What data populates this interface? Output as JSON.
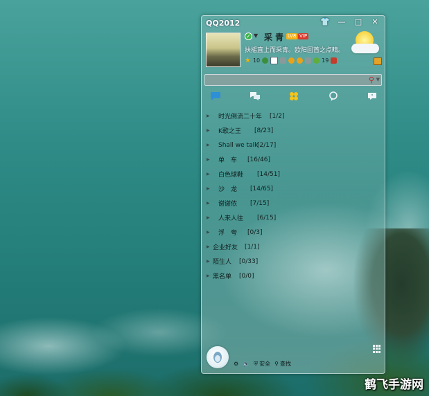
{
  "window": {
    "title": "QQ2012",
    "buttons": [
      "skin",
      "minimize",
      "maximize",
      "close"
    ]
  },
  "profile": {
    "nickname": "采 青",
    "badge_level": "LV8",
    "badge_vip": "VIP",
    "signature": "扶摇直上而采青。欧阳回首之点睛。",
    "status": "online",
    "info": {
      "level_value": "10",
      "green_count": "19"
    }
  },
  "search": {
    "value": "",
    "placeholder": ""
  },
  "tabs": [
    {
      "name": "contacts"
    },
    {
      "name": "groups"
    },
    {
      "name": "qzone"
    },
    {
      "name": "recent"
    },
    {
      "name": "messages"
    }
  ],
  "groups": [
    {
      "name": "时光倒流二十年",
      "count": "[1/2]"
    },
    {
      "name": "K歌之王",
      "count": "[8/23]"
    },
    {
      "name": "Shall we talk",
      "count": "[2/17]"
    },
    {
      "name": "单　车",
      "count": "[16/46]"
    },
    {
      "name": "白色球鞋",
      "count": "[14/51]"
    },
    {
      "name": "沙　龙",
      "count": "[14/65]"
    },
    {
      "name": "谢谢侬",
      "count": "[7/15]"
    },
    {
      "name": "人来人往",
      "count": "[6/15]"
    },
    {
      "name": "浮　夸",
      "count": "[0/3]"
    },
    {
      "name": "企业好友",
      "count": "[1/1]"
    },
    {
      "name": "陌生人",
      "count": "[0/33]"
    },
    {
      "name": "黑名单",
      "count": "[0/0]"
    }
  ],
  "bottom": {
    "security_label": "安全",
    "find_label": "查找"
  },
  "watermark": "鹤飞手游网",
  "colors": {
    "accent": "#3fb34a",
    "vip": "#d83a2c",
    "level": "#f3b21a"
  }
}
